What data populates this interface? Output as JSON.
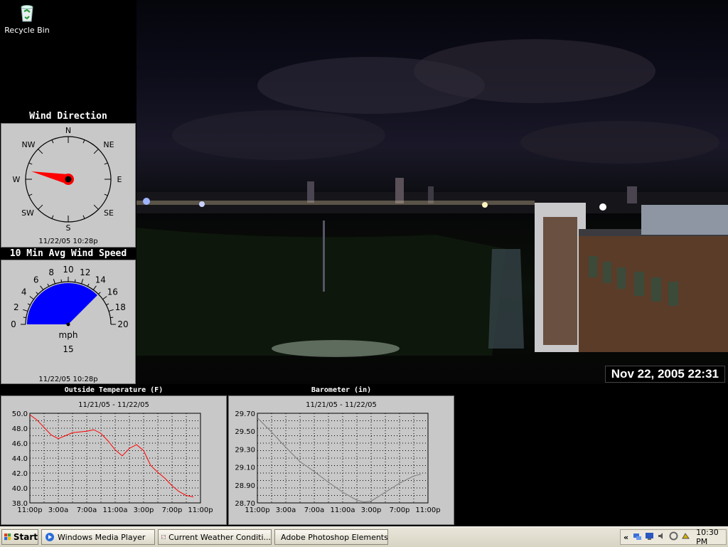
{
  "desktop": {
    "recycle_bin_label": "Recycle Bin"
  },
  "wind_direction": {
    "title": "Wind Direction",
    "compass_labels": {
      "n": "N",
      "ne": "NE",
      "e": "E",
      "se": "SE",
      "s": "S",
      "sw": "SW",
      "w": "W",
      "nw": "NW"
    },
    "direction_degrees": 282,
    "timestamp": "11/22/05  10:28p"
  },
  "wind_speed": {
    "title": "10 Min Avg Wind Speed",
    "gauge_ticks": [
      "0",
      "2",
      "4",
      "6",
      "8",
      "10",
      "12",
      "14",
      "16",
      "18",
      "20"
    ],
    "unit": "mph",
    "value": "15",
    "timestamp": "11/22/05  10:28p"
  },
  "webcam": {
    "timestamp": "Nov 22, 2005 22:31"
  },
  "chart_data": [
    {
      "type": "line",
      "title": "Outside Temperature (F)",
      "subtitle": "11/21/05 - 11/22/05",
      "x_tick_labels": [
        "11:00p",
        "3:00a",
        "7:00a",
        "11:00a",
        "3:00p",
        "7:00p",
        "11:00p"
      ],
      "y_tick_labels": [
        "50.0",
        "48.0",
        "46.0",
        "44.0",
        "42.0",
        "40.0",
        "38.0"
      ],
      "ylim": [
        38.0,
        50.0
      ],
      "xlim": [
        0,
        24
      ],
      "grid": true,
      "color": "#ff0000",
      "x": [
        0,
        1,
        2,
        3,
        4,
        5,
        6,
        7,
        8,
        9,
        10,
        11,
        12,
        13,
        14,
        15,
        16,
        17,
        18,
        19,
        20,
        21,
        22,
        23
      ],
      "y": [
        49.8,
        49.1,
        48.1,
        47.1,
        46.6,
        47.0,
        47.4,
        47.5,
        47.6,
        47.8,
        47.3,
        46.3,
        45.1,
        44.3,
        45.3,
        45.8,
        45.0,
        43.0,
        42.1,
        41.3,
        40.3,
        39.5,
        39.0,
        38.8
      ]
    },
    {
      "type": "line",
      "title": "Barometer (in)",
      "subtitle": "11/21/05 - 11/22/05",
      "x_tick_labels": [
        "11:00p",
        "3:00a",
        "7:00a",
        "11:00a",
        "3:00p",
        "7:00p",
        "11:00p"
      ],
      "y_tick_labels": [
        "29.70",
        "29.50",
        "29.30",
        "29.10",
        "28.90",
        "28.70"
      ],
      "ylim": [
        28.7,
        29.7
      ],
      "xlim": [
        0,
        24
      ],
      "grid": true,
      "color": "#777777",
      "x": [
        0,
        2,
        4,
        6,
        8,
        10,
        12,
        14,
        15,
        16,
        17,
        18,
        20,
        22,
        23
      ],
      "y": [
        29.65,
        29.49,
        29.32,
        29.16,
        29.05,
        28.93,
        28.82,
        28.73,
        28.71,
        28.72,
        28.77,
        28.82,
        28.92,
        29.0,
        29.02
      ]
    }
  ],
  "taskbar": {
    "start_label": "Start",
    "tasks": [
      "Windows Media Player",
      "Current Weather Conditi...",
      "Adobe Photoshop Elements"
    ],
    "tray_chevron": "«",
    "clock": "10:30 PM"
  }
}
